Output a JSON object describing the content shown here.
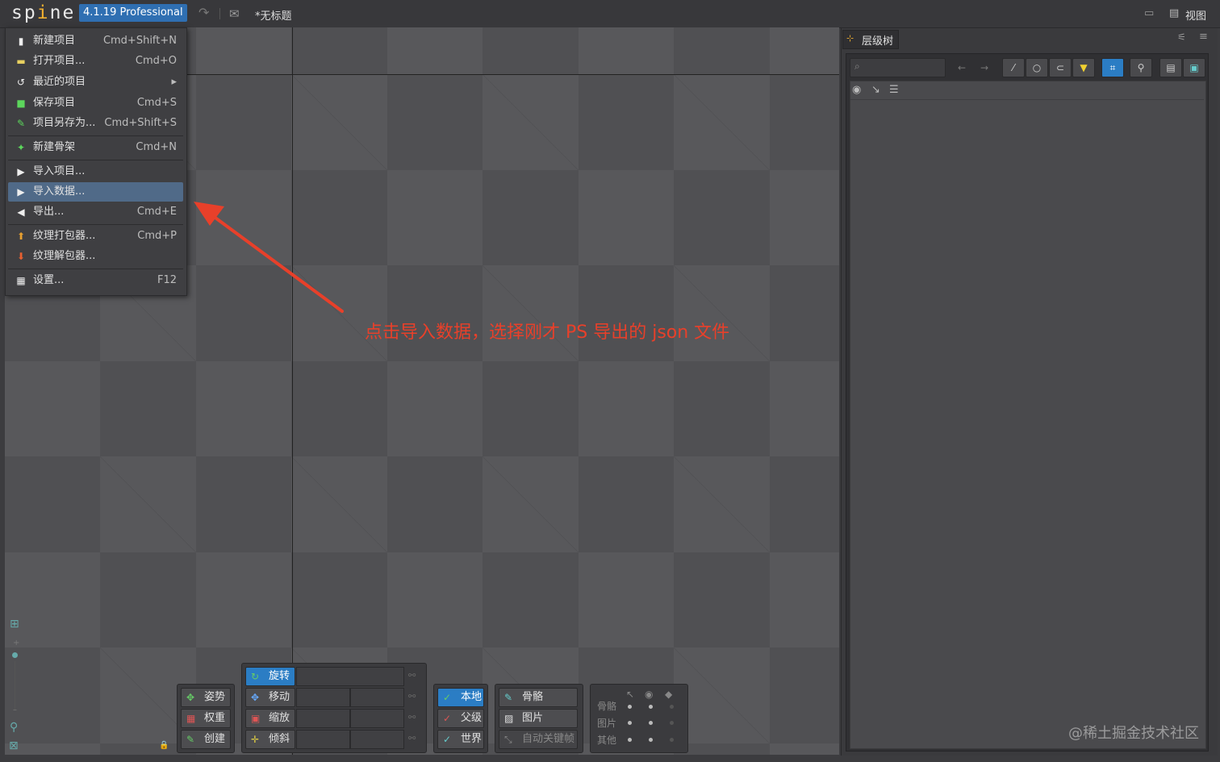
{
  "app": {
    "logo": "spine",
    "version": "4.1.19 Professional",
    "document_title": "*无标题",
    "view_label": "视图"
  },
  "menu": {
    "items": [
      {
        "label": "新建项目",
        "shortcut": "Cmd+Shift+N",
        "icon": "new-project-icon"
      },
      {
        "label": "打开项目...",
        "shortcut": "Cmd+O",
        "icon": "folder-icon"
      },
      {
        "label": "最近的项目",
        "shortcut": "▸",
        "icon": "history-icon"
      },
      {
        "label": "保存项目",
        "shortcut": "Cmd+S",
        "icon": "save-icon"
      },
      {
        "label": "项目另存为...",
        "shortcut": "Cmd+Shift+S",
        "icon": "save-as-icon"
      },
      {
        "label": "新建骨架",
        "shortcut": "Cmd+N",
        "icon": "skeleton-icon"
      },
      {
        "label": "导入项目...",
        "shortcut": "",
        "icon": "import-icon"
      },
      {
        "label": "导入数据...",
        "shortcut": "",
        "icon": "import-data-icon",
        "selected": true
      },
      {
        "label": "导出...",
        "shortcut": "Cmd+E",
        "icon": "export-icon"
      },
      {
        "label": "纹理打包器...",
        "shortcut": "Cmd+P",
        "icon": "texture-packer-icon"
      },
      {
        "label": "纹理解包器...",
        "shortcut": "",
        "icon": "texture-unpacker-icon"
      },
      {
        "label": "设置...",
        "shortcut": "F12",
        "icon": "settings-icon"
      }
    ]
  },
  "annotation": "点击导入数据，选择刚才 PS 导出的 json 文件",
  "hierarchy": {
    "tab_label": "层级树"
  },
  "tools": {
    "pose": "姿势",
    "weights": "权重",
    "create": "创建",
    "rotate": "旋转",
    "translate": "移动",
    "scale": "缩放",
    "shear": "倾斜",
    "local": "本地",
    "parent": "父级",
    "world": "世界",
    "bones": "骨骼",
    "images": "图片",
    "auto_key": "自动关键帧"
  },
  "compensation": {
    "rows": [
      "骨骼",
      "图片",
      "其他"
    ]
  },
  "watermark": "@稀土掘金技术社区",
  "colors": {
    "accent": "#2b7dc4",
    "annotation": "#e8402a",
    "selection": "#506a88"
  }
}
